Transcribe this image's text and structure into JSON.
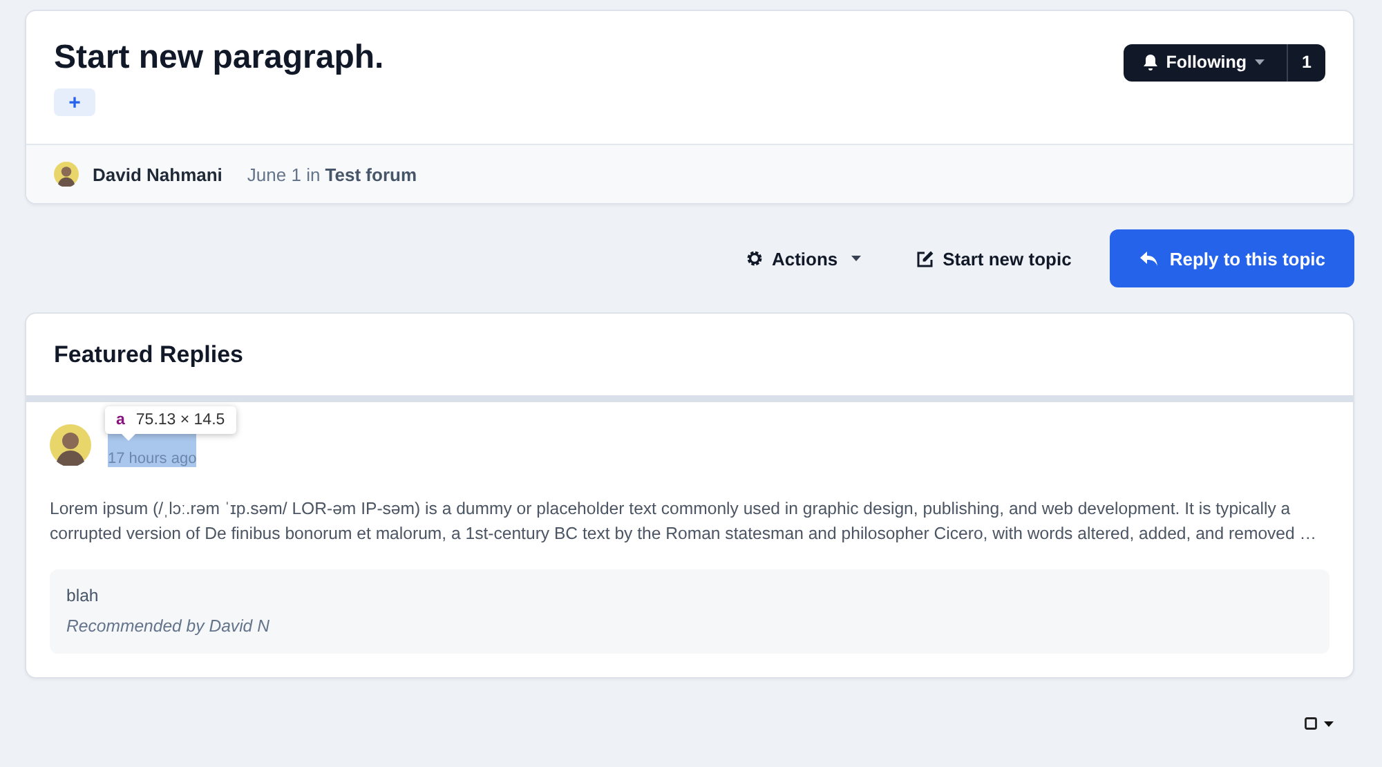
{
  "topic": {
    "title": "Start new paragraph.",
    "add_tag_label": "+",
    "follow": {
      "label": "Following",
      "count": "1"
    },
    "author": "David Nahmani",
    "date": "June 1",
    "in_word": "in",
    "forum": "Test forum"
  },
  "actions": [
    {
      "kind": "menu",
      "label": "Actions"
    },
    {
      "kind": "link",
      "label": "Start new topic"
    },
    {
      "kind": "primary",
      "label": "Reply to this topic"
    }
  ],
  "featured": {
    "title": "Featured Replies",
    "replies": [
      {
        "time": "17 hours ago",
        "time_selected": true,
        "body": "Lorem ipsum (/ˌlɔː.rəm ˈɪp.səm/ LOR-əm IP-səm) is a dummy or placeholder text commonly used in graphic design, publishing, and web development. It is typically a corrupted version of De finibus bonorum et malorum, a 1st-century BC text by the Roman statesman and philosopher Cicero, with words altered, added, and removed …",
        "quote": "blah",
        "recommended": "Recommended by David N"
      }
    ]
  },
  "inspector_tooltip": {
    "tag": "a",
    "size": "75.13 × 14.5"
  }
}
